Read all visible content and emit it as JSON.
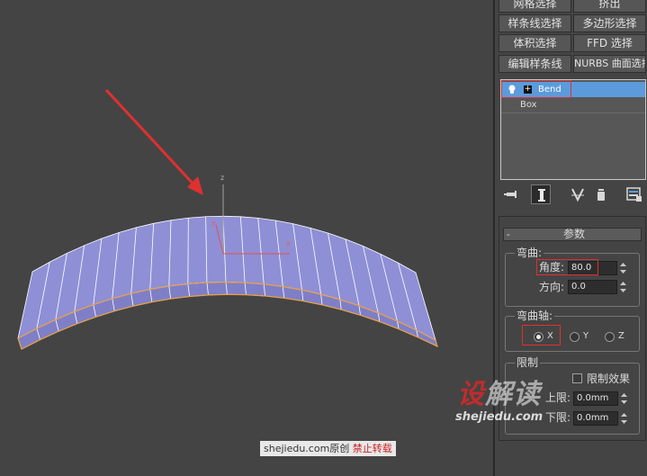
{
  "modifier_buttons": {
    "row1": [
      "网格选择",
      "挤出"
    ],
    "row2": [
      "样条线选择",
      "多边形选择"
    ],
    "row3": [
      "体积选择",
      "FFD 选择"
    ],
    "row4": [
      "编辑样条线",
      "NURBS 曲面选择"
    ]
  },
  "modifier_stack": {
    "items": [
      {
        "label": "Bend",
        "selected": true,
        "icon": "lightbulb-icon"
      },
      {
        "label": "Box",
        "selected": false
      }
    ]
  },
  "stack_toolbar": {
    "icons": [
      "pin-stack-icon",
      "show-end-result-icon",
      "make-unique-icon",
      "remove-modifier-icon",
      "configure-sets-icon"
    ]
  },
  "rollout": {
    "toggle": "-",
    "title": "参数",
    "bend_group": {
      "title": "弯曲:",
      "angle_label": "角度:",
      "angle_value": "80.0",
      "direction_label": "方向:",
      "direction_value": "0.0"
    },
    "axis_group": {
      "title": "弯曲轴:",
      "options": [
        "X",
        "Y",
        "Z"
      ],
      "selected": "X"
    },
    "limit_group": {
      "title": "限制",
      "limit_effect_label": "限制效果",
      "limit_effect_checked": false,
      "upper_label": "上限:",
      "upper_value": "0.0mm",
      "lower_label": "下限:",
      "lower_value": "0.0mm"
    }
  },
  "viewport": {
    "gizmo_axes": {
      "z": "z",
      "y": "y",
      "x": "x"
    }
  },
  "watermark": {
    "logo_first": "设",
    "logo_rest": "解读",
    "url": "shejiedu.com"
  },
  "credit": {
    "site": "shejiedu.com",
    "original": "原创",
    "forbid": "禁止转载"
  },
  "colors": {
    "viewport_bg": "#444444",
    "mesh_fill": "#8f8fd6",
    "edge_highlight": "#e8a040",
    "selection_blue": "#5b9bdb",
    "annotation_red": "#e03030"
  }
}
